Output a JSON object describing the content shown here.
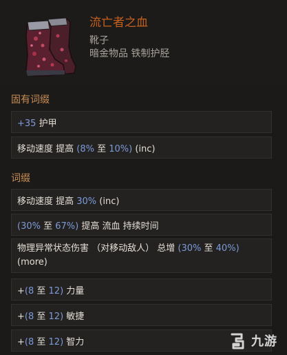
{
  "item": {
    "name": "流亡者之血",
    "type": "靴子",
    "subtype": "暗金物品 铁制护胫",
    "icon": "boots-icon"
  },
  "implicit": {
    "title": "固有词缀",
    "row1": {
      "prefix": "+",
      "value": "35",
      "text": " 护甲"
    },
    "row2": {
      "text_a": "移动速度 提高 ",
      "open": "(",
      "v1": "8%",
      "mid": " 至 ",
      "v2": "10%",
      "close": ")",
      "suffix": " (inc)"
    }
  },
  "mods": {
    "title": "词缀",
    "row1": {
      "text_a": "移动速度 提高 ",
      "value": "30%",
      "suffix": " (inc)"
    },
    "row2": {
      "open": "(",
      "v1": "30%",
      "mid": " 至 ",
      "v2": "67%",
      "close": ")",
      "suffix": " 提高 流血 持续时间"
    },
    "row3": {
      "text_a": "物理异常状态伤害 （对移动敌人） 总增 ",
      "open": "(",
      "v1": "30%",
      "mid": " 至 ",
      "v2": "40%",
      "close": ")",
      "suffix": " (more)"
    },
    "row4": {
      "prefix": "+",
      "open": "(",
      "v1": "8",
      "mid": " 至 ",
      "v2": "12",
      "close": ")",
      "suffix": " 力量"
    },
    "row5": {
      "prefix": "+",
      "open": "(",
      "v1": "8",
      "mid": " 至 ",
      "v2": "12",
      "close": ")",
      "suffix": " 敏捷"
    },
    "row6": {
      "prefix": "+",
      "open": "(",
      "v1": "8",
      "mid": " 至 ",
      "v2": "12",
      "close": ")",
      "suffix": " 智力"
    }
  },
  "watermark": {
    "text": "九游",
    "icon": "jiuyou-logo-icon"
  },
  "colors": {
    "item_name": "#c6601e",
    "section_title": "#c98e55",
    "value_blue": "#7c9bd9"
  }
}
